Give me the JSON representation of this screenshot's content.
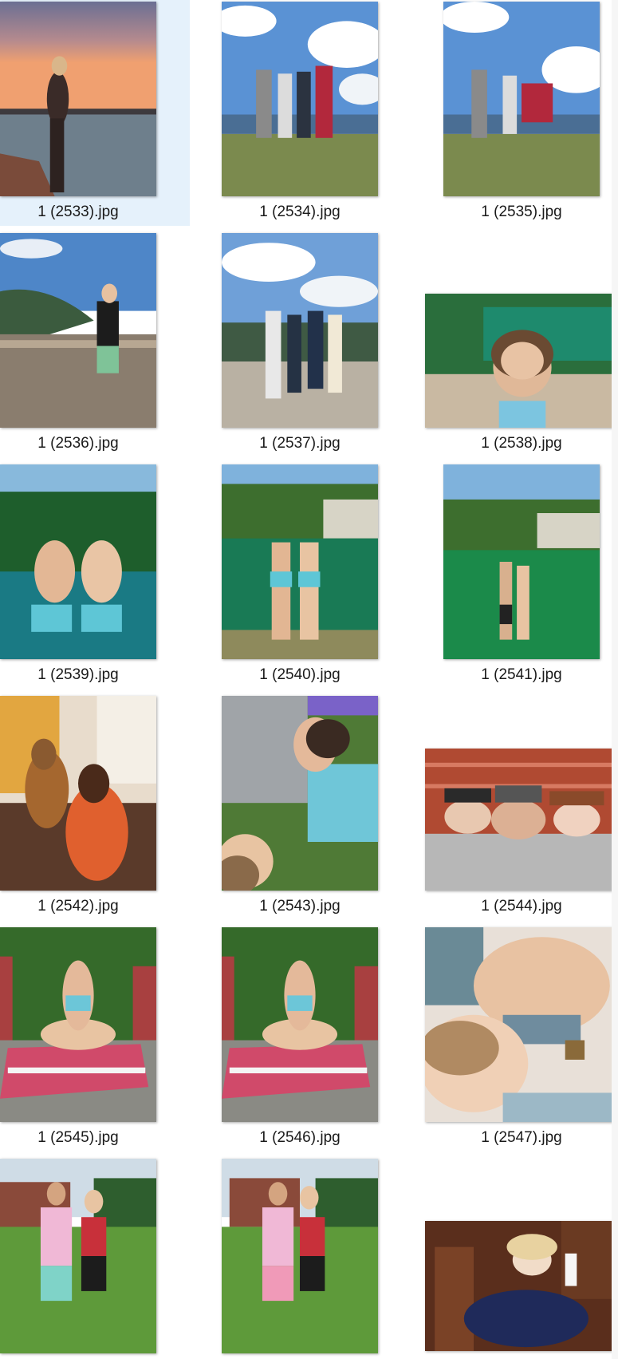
{
  "files": [
    {
      "name": "1 (2533).jpg",
      "icon": "image-thumbnail-icon",
      "selected": true
    },
    {
      "name": "1 (2534).jpg",
      "icon": "image-thumbnail-icon"
    },
    {
      "name": "1 (2535).jpg",
      "icon": "image-thumbnail-icon"
    },
    {
      "name": "1 (2536).jpg",
      "icon": "image-thumbnail-icon"
    },
    {
      "name": "1 (2537).jpg",
      "icon": "image-thumbnail-icon"
    },
    {
      "name": "1 (2538).jpg",
      "icon": "image-thumbnail-icon"
    },
    {
      "name": "1 (2539).jpg",
      "icon": "image-thumbnail-icon"
    },
    {
      "name": "1 (2540).jpg",
      "icon": "image-thumbnail-icon"
    },
    {
      "name": "1 (2541).jpg",
      "icon": "image-thumbnail-icon"
    },
    {
      "name": "1 (2542).jpg",
      "icon": "image-thumbnail-icon"
    },
    {
      "name": "1 (2543).jpg",
      "icon": "image-thumbnail-icon"
    },
    {
      "name": "1 (2544).jpg",
      "icon": "image-thumbnail-icon"
    },
    {
      "name": "1 (2545).jpg",
      "icon": "image-thumbnail-icon"
    },
    {
      "name": "1 (2546).jpg",
      "icon": "image-thumbnail-icon"
    },
    {
      "name": "1 (2547).jpg",
      "icon": "image-thumbnail-icon"
    },
    {
      "name": "",
      "icon": "image-thumbnail-icon"
    },
    {
      "name": "",
      "icon": "image-thumbnail-icon"
    },
    {
      "name": "",
      "icon": "image-thumbnail-icon"
    }
  ],
  "colors": {
    "selection": "#e5f1fb",
    "caption_text": "#1a1a1a"
  }
}
